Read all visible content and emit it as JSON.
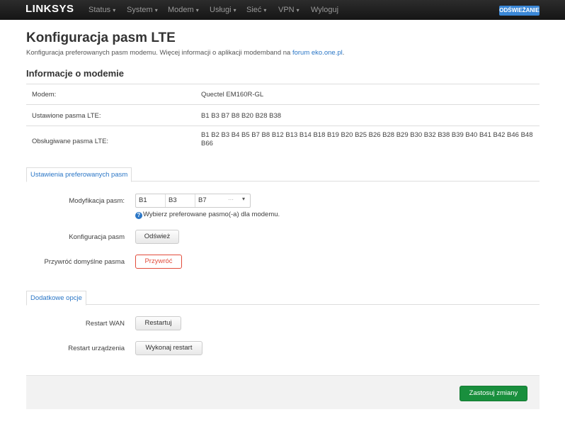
{
  "navbar": {
    "brand": "LINKSYS",
    "menu": [
      {
        "label": "Status"
      },
      {
        "label": "System"
      },
      {
        "label": "Modem"
      },
      {
        "label": "Usługi"
      },
      {
        "label": "Sieć"
      },
      {
        "label": "VPN"
      },
      {
        "label": "Wyloguj"
      }
    ],
    "refresh_badge": "ODŚWIEŻANIE"
  },
  "page": {
    "title": "Konfiguracja pasm LTE",
    "description": "Konfiguracja preferowanych pasm modemu. Więcej informacji o aplikacji modemband na ",
    "description_link": "forum eko.one.pl",
    "description_end": "."
  },
  "modem_info": {
    "title": "Informacje o modemie",
    "rows": [
      {
        "label": "Modem:",
        "value": "Quectel EM160R-GL"
      },
      {
        "label": "Ustawione pasma LTE:",
        "value": "B1 B3 B7 B8 B20 B28 B38"
      },
      {
        "label": "Obsługiwane pasma LTE:",
        "value": "B1 B2 B3 B4 B5 B7 B8 B12 B13 B14 B18 B19 B20 B25 B26 B28 B29 B30 B32 B38 B39 B40 B41 B42 B46 B48 B66"
      }
    ]
  },
  "preferred_bands": {
    "tab": "Ustawienia preferowanych pasm",
    "modification_label": "Modyfikacja pasm:",
    "selected": [
      "B1",
      "B3",
      "B7"
    ],
    "more": "···",
    "caret": "▾",
    "help_text": "Wybierz preferowane pasmo(-a) dla modemu.",
    "config_label": "Konfiguracja pasm",
    "refresh_button": "Odśwież",
    "restore_label": "Przywróć domyślne pasma",
    "restore_button": "Przywróć"
  },
  "extra_options": {
    "tab": "Dodatkowe opcje",
    "restart_wan_label": "Restart WAN",
    "restart_wan_button": "Restartuj",
    "restart_device_label": "Restart urządzenia",
    "restart_device_button": "Wykonaj restart"
  },
  "footer": {
    "apply_button": "Zastosuj zmiany"
  },
  "colors": {
    "accent": "#2a76c6",
    "danger": "#e24b3a",
    "success": "#198f3d",
    "navbar": "#1b1b1b"
  }
}
